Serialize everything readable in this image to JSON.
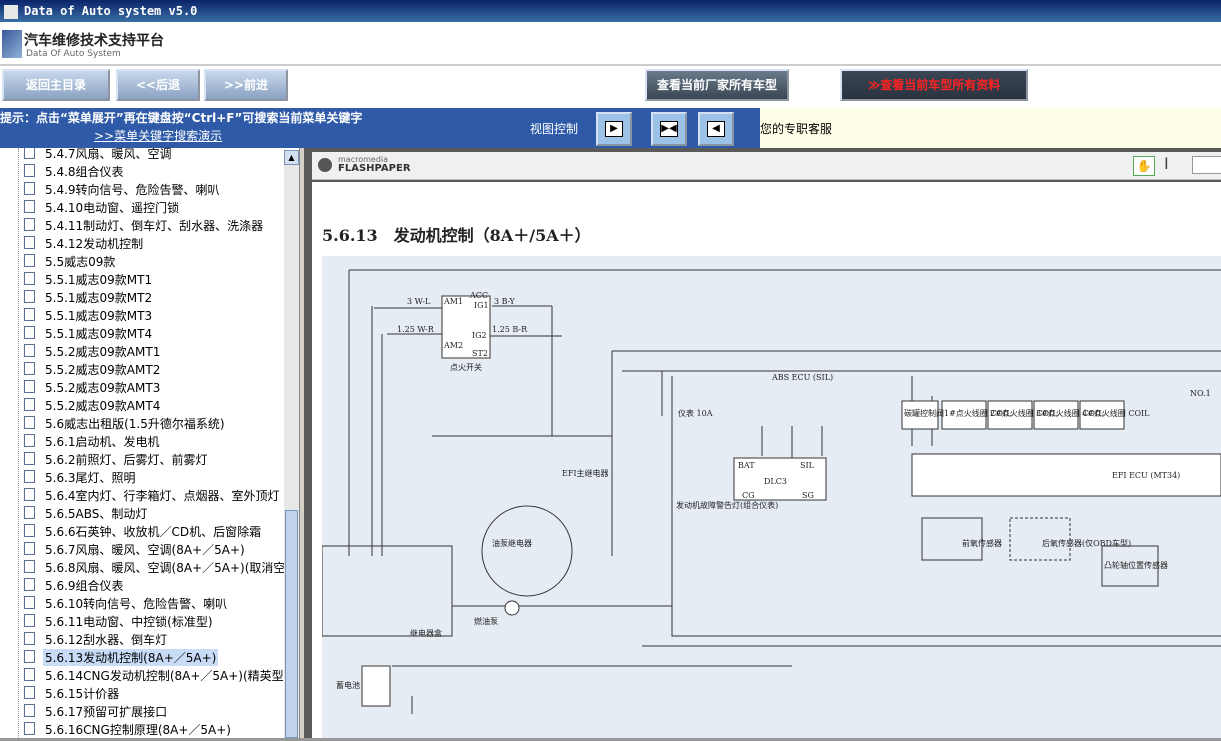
{
  "window": {
    "title": "Data of Auto system v5.0"
  },
  "app": {
    "title": "汽车维修技术支持平台",
    "subtitle": "Data Of Auto System"
  },
  "toolbar": {
    "home": "返回主目录",
    "back": "<<后退",
    "forward": ">>前进",
    "all_makes": "查看当前厂家所有车型",
    "all_data": "≫查看当前车型所有资料"
  },
  "hint": {
    "text": "提示：点击“菜单展开”再在键盘按“Ctrl+F”可搜索当前菜单关键字",
    "link": ">>菜单关键字搜索演示",
    "view_label": "视图控制"
  },
  "info": {
    "text": "您的专职客服"
  },
  "tree": {
    "items": [
      "5.4.7风扇、暖风、空调",
      "5.4.8组合仪表",
      "5.4.9转向信号、危险告警、喇叭",
      "5.4.10电动窗、遥控门锁",
      "5.4.11制动灯、倒车灯、刮水器、洗涤器",
      "5.4.12发动机控制",
      "5.5威志09款",
      "5.5.1威志09款MT1",
      "5.5.1威志09款MT2",
      "5.5.1威志09款MT3",
      "5.5.1威志09款MT4",
      "5.5.2威志09款AMT1",
      "5.5.2威志09款AMT2",
      "5.5.2威志09款AMT3",
      "5.5.2威志09款AMT4",
      "5.6威志出租版(1.5升德尔福系统)",
      "5.6.1启动机、发电机",
      "5.6.2前照灯、后雾灯、前雾灯",
      "5.6.3尾灯、照明",
      "5.6.4室内灯、行李箱灯、点烟器、室外顶灯",
      "5.6.5ABS、制动灯",
      "5.6.6石英钟、收放机／CD机、后窗除霜",
      "5.6.7风扇、暖风、空调(8A+／5A+)",
      "5.6.8风扇、暖风、空调(8A+／5A+)(取消空",
      "5.6.9组合仪表",
      "5.6.10转向信号、危险告警、喇叭",
      "5.6.11电动窗、中控锁(标准型)",
      "5.6.12刮水器、倒车灯",
      "5.6.13发动机控制(8A+／5A+)",
      "5.6.14CNG发动机控制(8A+／5A+)(精英型)",
      "5.6.15计价器",
      "5.6.17预留可扩展接口",
      "5.6.16CNG控制原理(8A+／5A+)"
    ]
  },
  "viewer": {
    "brand_small": "macromedia",
    "brand_main": "FLASHPAPER",
    "page_title": "5.6.13　发动机控制（8A＋/5A＋）"
  },
  "diagram_labels": {
    "ignition": "点火开关",
    "acc": "ACC",
    "ig1": "IG1",
    "ig2": "IG2",
    "st2": "ST2",
    "am1": "AM1",
    "am2": "AM2",
    "w1": "3 W-L",
    "w2": "3 B-Y",
    "w3": "1.25 W-R",
    "w4": "1.25 B-R",
    "relay_box": "继电器盒",
    "battery": "蓄电池",
    "pump_relay": "油泵继电器",
    "fuel_pump": "燃油泵",
    "efi_relay": "EFI主继电器",
    "meter": "仪表 10A",
    "mil": "发动机故障警告灯(组合仪表)",
    "abs": "ABS ECU (SIL)",
    "dlc": "DLC3",
    "bat": "BAT",
    "sil": "SIL",
    "cg": "CG",
    "sg": "SG",
    "canister": "碳罐控制阀",
    "coil1": "1#点火线圈 COIL",
    "coil2": "2#点火线圈 COIL",
    "coil3": "3#点火线圈 COIL",
    "coil4": "4#点火线圈 COIL",
    "front_o2": "前氧传感器",
    "rear_o2": "后氧传感器(仅OBD车型)",
    "cam": "凸轮轴位置传感器",
    "ecu": "EFI ECU (MT34)",
    "no1": "NO.1"
  }
}
